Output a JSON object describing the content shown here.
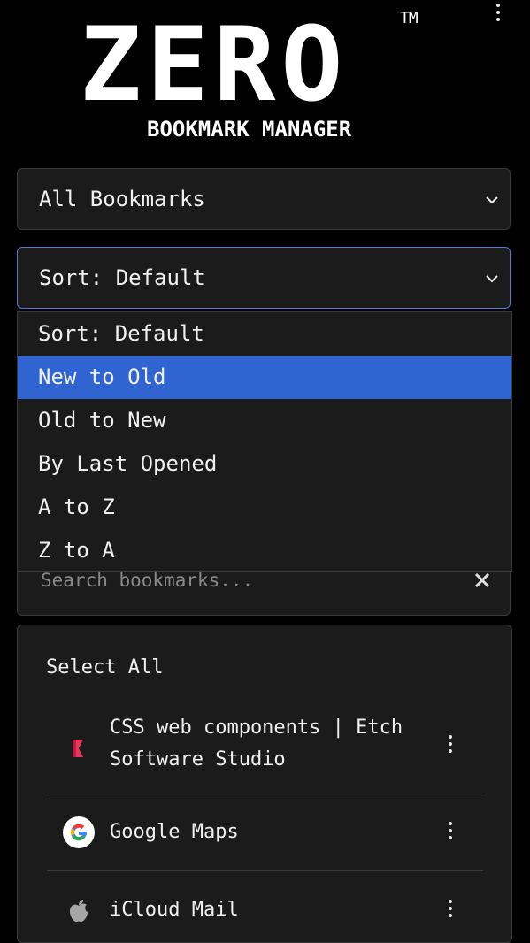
{
  "header": {
    "logo_word": "ZERO",
    "logo_tm": "TM",
    "logo_subtitle": "BOOKMARK MANAGER"
  },
  "folder_select": {
    "selected_label": "All Bookmarks"
  },
  "sort_select": {
    "selected_label": "Sort: Default",
    "options": [
      {
        "label": "Sort: Default"
      },
      {
        "label": "New to Old"
      },
      {
        "label": "Old to New"
      },
      {
        "label": "By Last Opened"
      },
      {
        "label": "A to Z"
      },
      {
        "label": "Z to A"
      }
    ],
    "highlighted_option": "New to Old"
  },
  "search": {
    "placeholder": "Search bookmarks...",
    "value": ""
  },
  "list": {
    "select_all_label": "Select All",
    "bookmarks": [
      {
        "title": "CSS web components | Etch Software Studio",
        "icon": "etch-logo-icon"
      },
      {
        "title": "Google Maps",
        "icon": "google-logo-icon"
      },
      {
        "title": "iCloud Mail",
        "icon": "apple-logo-icon"
      }
    ]
  },
  "colors": {
    "background": "#000000",
    "panel": "#1b1b1b",
    "border": "#3a3a3a",
    "highlight": "#3064d0",
    "focus_border": "#4a7bd6"
  }
}
